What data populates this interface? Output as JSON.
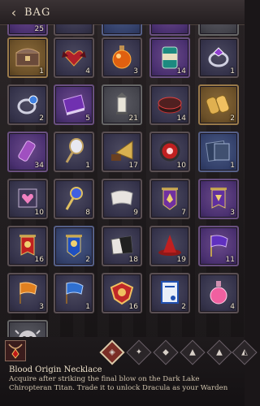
{
  "header": {
    "title": "BAG"
  },
  "top_row_partial": [
    {
      "qty": "25"
    },
    {
      "qty": ""
    },
    {
      "qty": ""
    },
    {
      "qty": ""
    },
    {
      "qty": ""
    }
  ],
  "items": [
    {
      "name": "treasure-chest",
      "qty": "1"
    },
    {
      "name": "winged-heart-ornament",
      "qty": "4"
    },
    {
      "name": "orange-potion",
      "qty": "3"
    },
    {
      "name": "canned-drink",
      "qty": "14"
    },
    {
      "name": "silver-ring-purple-gem",
      "qty": "1"
    },
    {
      "name": "silver-ring-blue-gem",
      "qty": "2"
    },
    {
      "name": "purple-book",
      "qty": "5"
    },
    {
      "name": "lantern",
      "qty": "21"
    },
    {
      "name": "ornate-box",
      "qty": "14"
    },
    {
      "name": "golden-scrolls",
      "qty": "2"
    },
    {
      "name": "purple-scroll",
      "qty": "34"
    },
    {
      "name": "hand-mirror",
      "qty": "1"
    },
    {
      "name": "gramophone",
      "qty": "17"
    },
    {
      "name": "round-mirror",
      "qty": "10"
    },
    {
      "name": "framed-picture",
      "qty": "1"
    },
    {
      "name": "pink-heart-frame",
      "qty": "10"
    },
    {
      "name": "magic-wand",
      "qty": "8"
    },
    {
      "name": "white-banner",
      "qty": "9"
    },
    {
      "name": "purple-crest-banner",
      "qty": "7"
    },
    {
      "name": "purple-flag-banner",
      "qty": "3"
    },
    {
      "name": "red-banner",
      "qty": "16"
    },
    {
      "name": "blue-banner",
      "qty": "2"
    },
    {
      "name": "dark-banner",
      "qty": "18"
    },
    {
      "name": "red-witch-hat",
      "qty": "19"
    },
    {
      "name": "purple-flag",
      "qty": "11"
    },
    {
      "name": "orange-flag",
      "qty": "3"
    },
    {
      "name": "blue-flag",
      "qty": "1"
    },
    {
      "name": "shield-emblem",
      "qty": "16"
    },
    {
      "name": "blue-certificate",
      "qty": "2"
    },
    {
      "name": "pink-potion",
      "qty": "4"
    },
    {
      "name": "skull-mask",
      "qty": ""
    }
  ],
  "tabs": [
    {
      "icon": "item-grid-icon",
      "glyph": "◈"
    },
    {
      "icon": "gear-tab-icon",
      "glyph": "✦"
    },
    {
      "icon": "gem-tab-icon",
      "glyph": "◆"
    },
    {
      "icon": "bag-tab-icon",
      "glyph": "▲"
    },
    {
      "icon": "hat-tab-icon",
      "glyph": "▲"
    },
    {
      "icon": "crown-tab-icon",
      "glyph": "◭"
    }
  ],
  "selected": {
    "name": "Blood Origin Necklace",
    "description": "Acquire after striking the final blow on the Dark Lake Chiropteran Titan. Trade it to unlock Dracula as your Warden"
  }
}
